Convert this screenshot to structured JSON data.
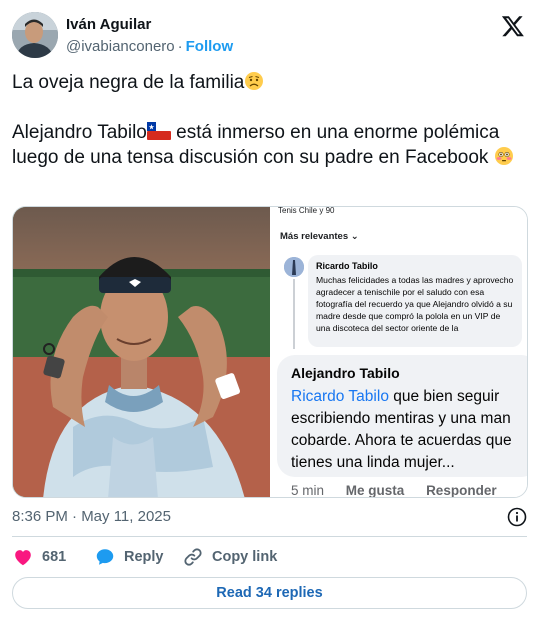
{
  "author": {
    "name": "Iván Aguilar",
    "handle": "@ivabianconero",
    "separator": "·",
    "follow_label": "Follow"
  },
  "tweet": {
    "line1": "La oveja negra de la familia",
    "line2_part1": "Alejandro Tabilo",
    "line2_part2": " está inmerso en una enorme polémica luego de una tensa discusión con su padre en Facebook"
  },
  "media": {
    "screenshot": {
      "topbar": "Tenis Chile y 90",
      "sort_label": "Más relevantes",
      "comment1": {
        "author": "Ricardo Tabilo",
        "text": "Muchas felicidades a todas las madres y aprovecho agradecer a tenischile por el saludo con esa fotografía del recuerdo ya que Alejandro olvidó a su madre desde que compró la polola en un VIP de una discoteca del sector oriente de la"
      },
      "comment2": {
        "author": "Alejandro Tabilo",
        "mention": "Ricardo Tabilo",
        "text": " que bien seguir escribiendo mentiras y una man cobarde. Ahora te acuerdas que tienes una linda mujer..."
      },
      "actions": {
        "time": "5 min",
        "like": "Me gusta",
        "reply": "Responder"
      }
    }
  },
  "timestamp": "8:36 PM · May 11, 2025",
  "engagement": {
    "likes": "681",
    "reply_label": "Reply",
    "copy_label": "Copy link"
  },
  "read_replies": "Read 34 replies",
  "colors": {
    "accent": "#1d9bf0",
    "like_red": "#f91880",
    "text_primary": "#0f1419",
    "text_secondary": "#536471",
    "fb_blue": "#1877f2"
  },
  "icons": {
    "x_logo": "x-logo-icon",
    "worried_emoji": "worried-face-emoji",
    "chile_flag": "chile-flag-emoji",
    "flushed_emoji": "flushed-face-emoji",
    "info": "info-icon",
    "heart": "heart-icon",
    "reply": "speech-bubble-icon",
    "link": "link-icon"
  }
}
